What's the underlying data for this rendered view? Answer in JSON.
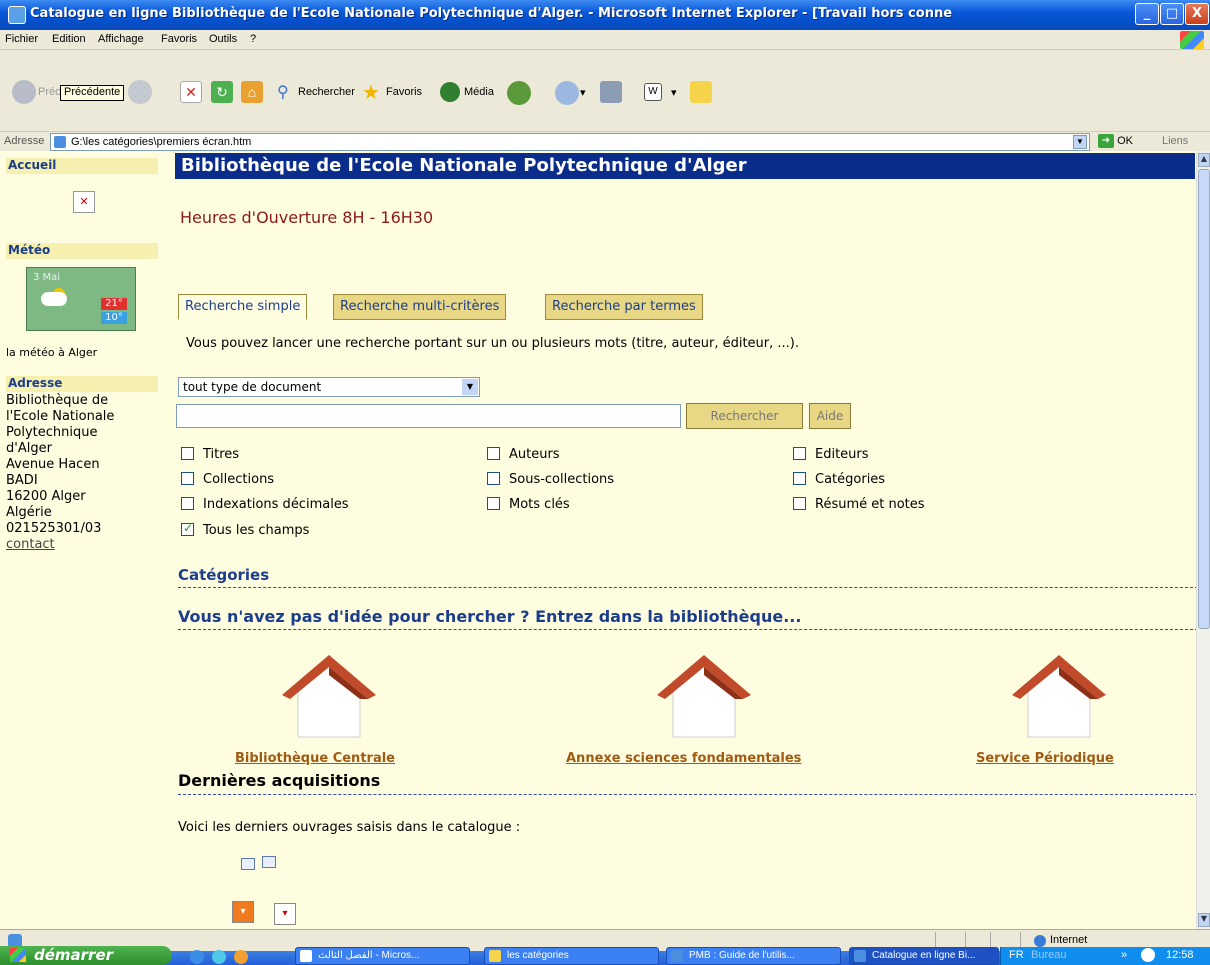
{
  "window": {
    "title": "Catalogue en ligne Bibliothèque de l'Ecole Nationale Polytechnique d'Alger. - Microsoft Internet Explorer - [Travail hors conne",
    "min_label": "_",
    "max_label": "□",
    "close_label": "X"
  },
  "menu": {
    "items": [
      "Fichier",
      "Edition",
      "Affichage",
      "Favoris",
      "Outils",
      "?"
    ]
  },
  "toolbar": {
    "back_label": "Précédente",
    "search_label": "Rechercher",
    "favorites_label": "Favoris",
    "media_label": "Média",
    "tooltip": "Précédente"
  },
  "address": {
    "label": "Adresse",
    "url": "G:\\les catégories\\premiers écran.htm",
    "go_label": "OK",
    "links_label": "Liens"
  },
  "sidebar": {
    "accueil": "Accueil",
    "meteo": "Météo",
    "meteo_date": "3 Mai",
    "meteo_max": "21°",
    "meteo_min": "10°",
    "meteo_caption": "la météo à Alger",
    "adresse": "Adresse",
    "address_lines": [
      "Bibliothèque de",
      "l'Ecole Nationale",
      "Polytechnique",
      "d'Alger",
      "Avenue Hacen",
      "BADI",
      "16200 Alger",
      "Algérie",
      "021525301/03"
    ],
    "contact": "contact"
  },
  "main": {
    "header": "Bibliothèque de l'Ecole Nationale Polytechnique d'Alger",
    "hours": "Heures d'Ouverture 8H - 16H30",
    "tabs": [
      "Recherche simple",
      "Recherche multi-critères",
      "Recherche par termes"
    ],
    "help_text": "Vous pouvez lancer une recherche portant sur un ou plusieurs mots (titre, auteur, éditeur, ...).",
    "doc_type": "tout type de document",
    "search_button": "Rechercher",
    "help_button": "Aide",
    "checkboxes": [
      {
        "label": "Titres",
        "checked": false
      },
      {
        "label": "Auteurs",
        "checked": false
      },
      {
        "label": "Editeurs",
        "checked": false
      },
      {
        "label": "Collections",
        "checked": false
      },
      {
        "label": "Sous-collections",
        "checked": false
      },
      {
        "label": "Catégories",
        "checked": false
      },
      {
        "label": "Indexations décimales",
        "checked": false
      },
      {
        "label": "Mots clés",
        "checked": false
      },
      {
        "label": "Résumé et notes",
        "checked": false
      },
      {
        "label": "Tous les champs",
        "checked": true
      }
    ],
    "categories_title": "Catégories",
    "discover_title": "Vous n'avez pas d'idée pour chercher ? Entrez dans la bibliothèque...",
    "branches": [
      "Bibliothèque Centrale",
      "Annexe sciences fondamentales",
      "Service Périodique"
    ],
    "acquisitions_title": "Dernières acquisitions",
    "acquisitions_text": "Voici les derniers ouvrages saisis dans le catalogue :"
  },
  "status": {
    "zone": "Internet"
  },
  "taskbar": {
    "start": "démarrer",
    "tasks": [
      "الفصل الثالث - Micros...",
      "les catégories",
      "PMB : Guide de l'utilis...",
      "Catalogue en ligne Bi..."
    ],
    "lang": "FR",
    "bureau": "Bureau",
    "time": "12:58"
  },
  "colors": {
    "page_bg": "#fffde0",
    "header_bg": "#0a2c8a",
    "link_brown": "#a05b12",
    "title_blue": "#1b3d8c",
    "hours_red": "#8b1a1a"
  }
}
